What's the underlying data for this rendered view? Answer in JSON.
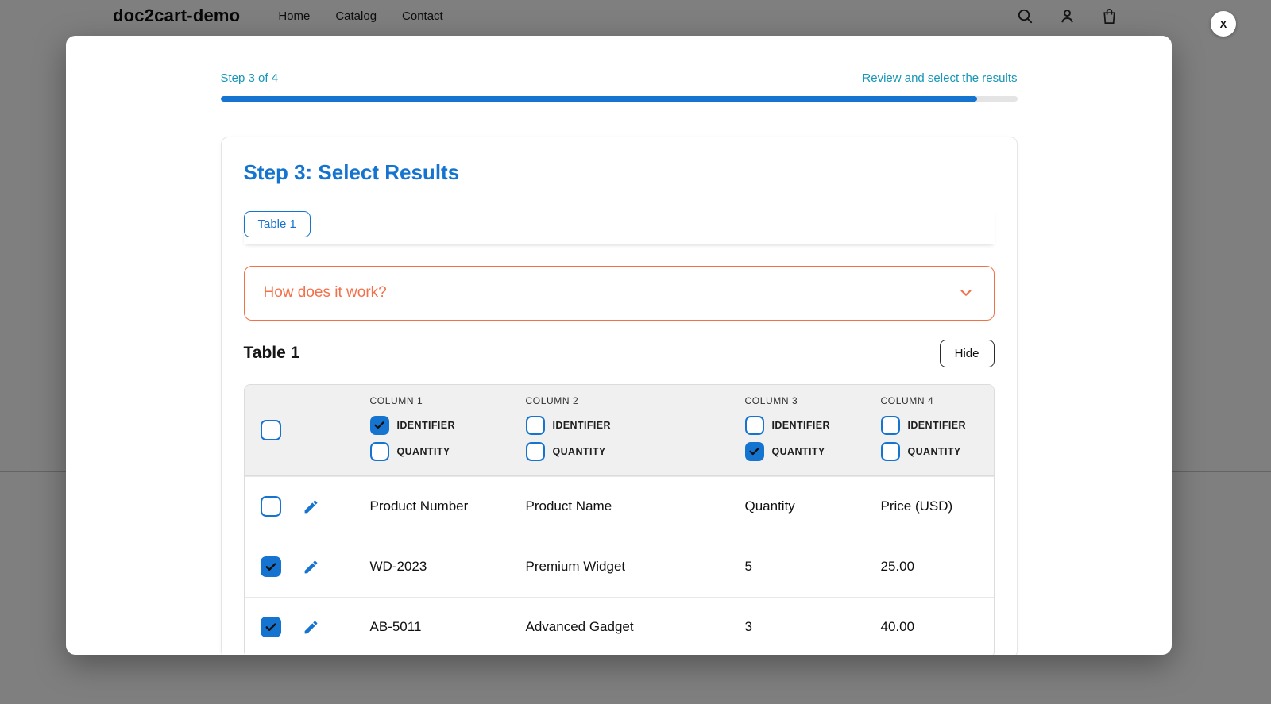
{
  "header": {
    "brand": "doc2cart-demo",
    "nav": [
      "Home",
      "Catalog",
      "Contact"
    ],
    "icons": [
      "search-icon",
      "account-icon",
      "cart-icon"
    ]
  },
  "modal": {
    "close_label": "X",
    "progress": {
      "step_label": "Step 3 of 4",
      "description": "Review and select the results",
      "percent": 95
    },
    "card": {
      "title": "Step 3: Select Results",
      "tabs": [
        {
          "label": "Table 1"
        }
      ],
      "accordion": {
        "label": "How does it work?"
      },
      "table_section": {
        "title": "Table 1",
        "hide_button": "Hide",
        "option_labels": {
          "identifier": "IDENTIFIER",
          "quantity": "QUANTITY"
        },
        "columns": [
          {
            "header": "COLUMN 1",
            "identifier_checked": true,
            "quantity_checked": false
          },
          {
            "header": "COLUMN 2",
            "identifier_checked": false,
            "quantity_checked": false
          },
          {
            "header": "COLUMN 3",
            "identifier_checked": false,
            "quantity_checked": true
          },
          {
            "header": "COLUMN 4",
            "identifier_checked": false,
            "quantity_checked": false
          }
        ],
        "select_all_checked": false,
        "rows": [
          {
            "selected": false,
            "cells": [
              "Product Number",
              "Product Name",
              "Quantity",
              "Price (USD)"
            ]
          },
          {
            "selected": true,
            "cells": [
              "WD-2023",
              "Premium Widget",
              "5",
              "25.00"
            ]
          },
          {
            "selected": true,
            "cells": [
              "AB-5011",
              "Advanced Gadget",
              "3",
              "40.00"
            ]
          }
        ]
      }
    }
  },
  "colors": {
    "blue": "#1574cf",
    "teal": "#1797b8",
    "orange": "#f3714a"
  }
}
